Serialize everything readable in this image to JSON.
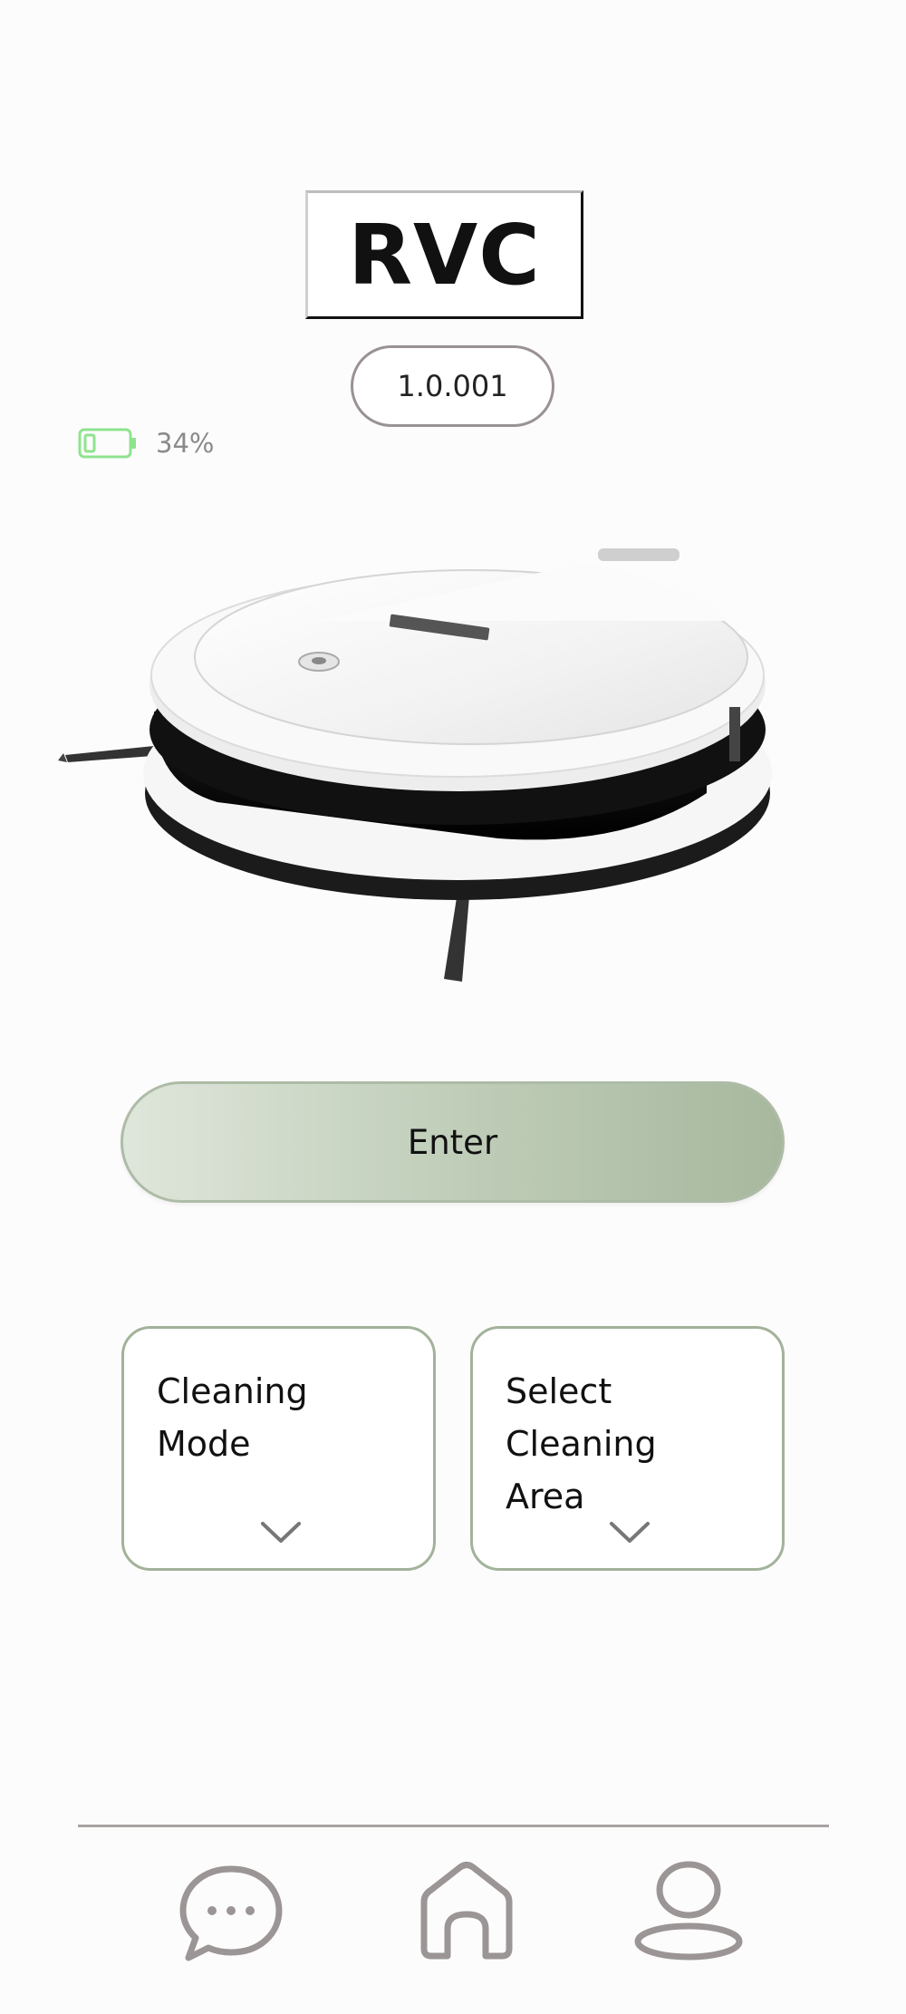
{
  "header": {
    "title": "RVC",
    "version": "1.0.001"
  },
  "status": {
    "battery_percent_label": "34%",
    "battery_level": 0.34,
    "battery_color": "#8fe38f"
  },
  "device": {
    "image_icon": "robot-vacuum"
  },
  "actions": {
    "enter_label": "Enter",
    "enter_gradient": [
      "#dfe6db",
      "#a7b89e"
    ]
  },
  "dropdowns": [
    {
      "label": "Cleaning\n Mode",
      "icon": "chevron-down-icon"
    },
    {
      "label": "Select\nCleaning\nArea",
      "icon": "chevron-down-icon"
    }
  ],
  "nav": {
    "items": [
      {
        "icon": "chat-icon"
      },
      {
        "icon": "home-icon"
      },
      {
        "icon": "user-icon"
      }
    ],
    "icon_color": "#9b9595"
  }
}
